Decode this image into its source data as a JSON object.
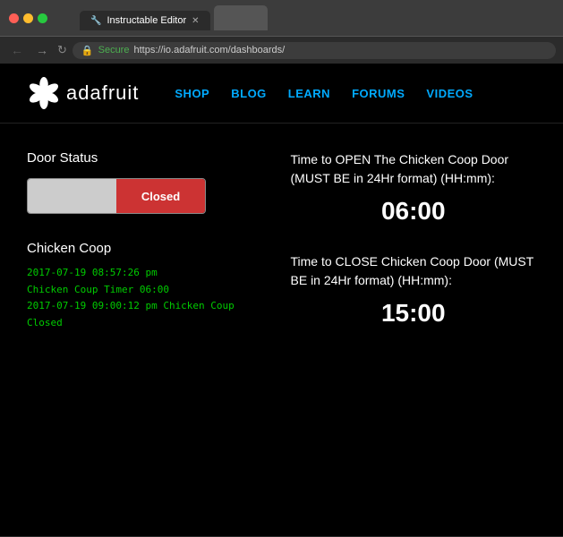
{
  "browser": {
    "tabs": [
      {
        "label": "Instructable Editor",
        "active": true,
        "favicon": "🔧"
      },
      {
        "label": "",
        "active": false,
        "favicon": ""
      }
    ],
    "url": {
      "secure_label": "Secure",
      "url_text": "https://io.adafruit.com/",
      "url_suffix": "dashboards/"
    },
    "nav": {
      "back": "←",
      "forward": "→",
      "refresh": "↻"
    }
  },
  "site": {
    "logo_text": "adafruit",
    "nav_items": [
      "SHOP",
      "BLOG",
      "LEARN",
      "FORUMS",
      "VIDEOS"
    ]
  },
  "dashboard": {
    "door_status": {
      "section_title": "Door Status",
      "open_label": "",
      "closed_label": "Closed"
    },
    "open_time": {
      "label": "Time to OPEN The Chicken Coop Door (MUST BE in 24Hr format) (HH:mm):",
      "value": "06:00"
    },
    "chicken_coop": {
      "title": "Chicken Coop",
      "logs": [
        "2017-07-19 08:57:26 pm",
        "Chicken Coup Timer 06:00",
        "2017-07-19 09:00:12 pm Chicken Coup",
        "Closed"
      ]
    },
    "close_time": {
      "label": "Time to CLOSE Chicken Coop Door (MUST BE in 24Hr format) (HH:mm):",
      "value": "15:00"
    }
  }
}
